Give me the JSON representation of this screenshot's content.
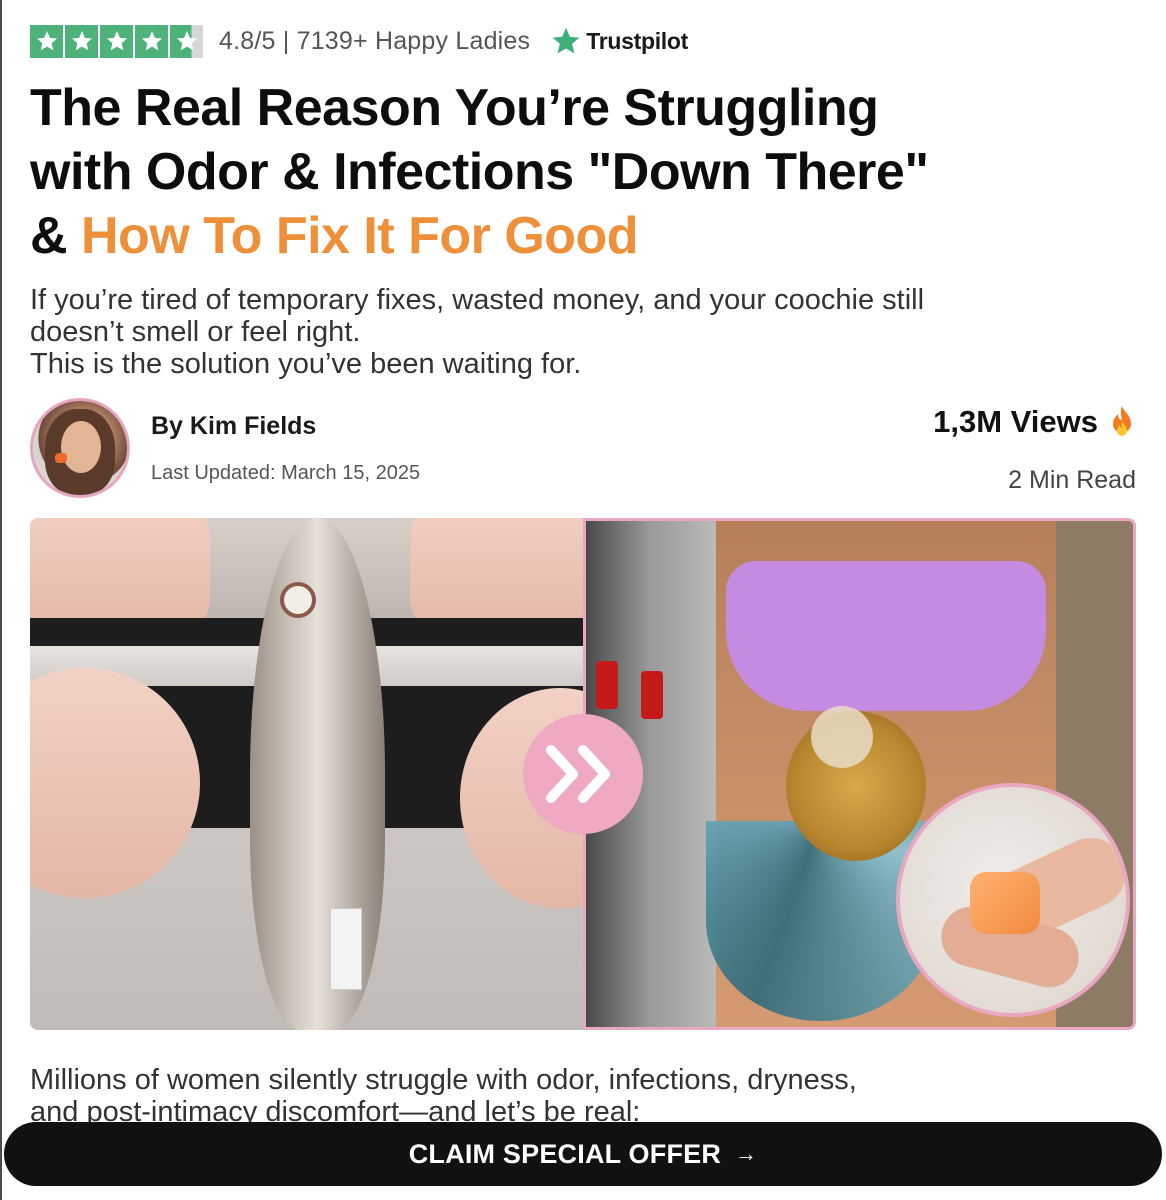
{
  "rating_bar": {
    "stars_filled": 4.8,
    "stars_max": 5,
    "text": "4.8/5 | 7139+ Happy Ladies",
    "trustpilot_label": "Trustpilot",
    "star_color": "#4db37a"
  },
  "headline": {
    "line1": "The Real Reason You’re Struggling",
    "line2": "with Odor & Infections \"Down There\"",
    "line3_prefix": "& ",
    "line3_accent": "How To Fix It For Good",
    "accent_color": "#ee8f3a"
  },
  "subheadline": {
    "line1": "If you’re tired of temporary fixes, wasted money, and your coochie still",
    "line2": "doesn’t smell or feel right.",
    "line3": "This is the solution you’ve been waiting for."
  },
  "author": {
    "byline": "By Kim Fields",
    "updated": "Last Updated: March 15, 2025",
    "views": "1,3M Views",
    "views_icon": "fire-icon",
    "read_time": "2 Min Read"
  },
  "hero_image": {
    "divider_icon": "double-chevron-right-icon",
    "frame_color": "#e9a7c2"
  },
  "body": {
    "line1": "Millions of women silently struggle with odor, infections, dryness,",
    "line2": "and post-intimacy discomfort—and let’s be real:"
  },
  "cta": {
    "label": "CLAIM SPECIAL OFFER",
    "arrow": "→"
  }
}
